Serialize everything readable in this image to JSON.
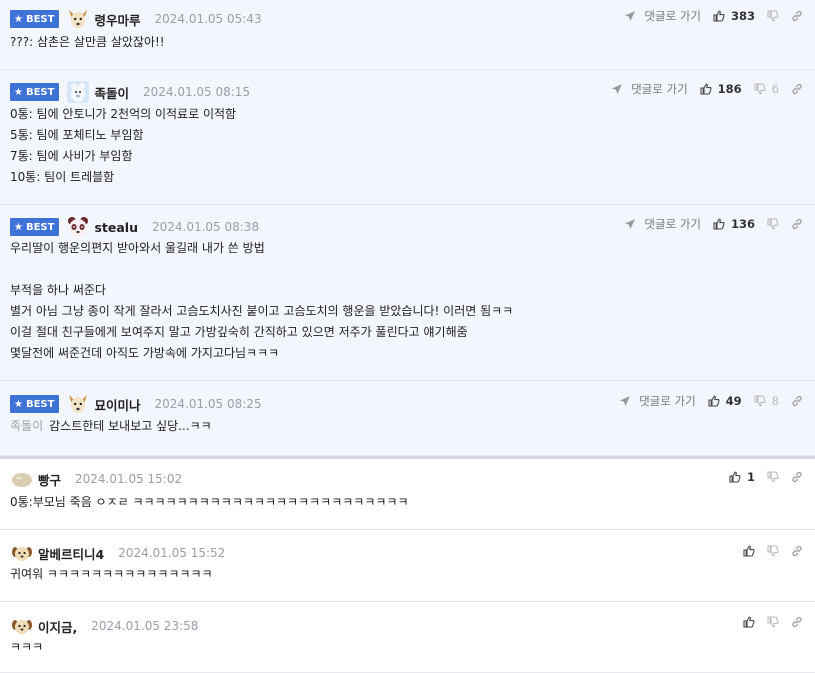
{
  "comments_best": [
    {
      "badge": "BEST",
      "nick": "령우마루",
      "date": "2024.01.05 05:43",
      "reply_link": "댓글로 가기",
      "likes": "383",
      "dislikes": "",
      "lines": [
        "???: 삼촌은 살만큼 살았잖아!!"
      ]
    },
    {
      "badge": "BEST",
      "nick": "족돌이",
      "date": "2024.01.05 08:15",
      "reply_link": "댓글로 가기",
      "likes": "186",
      "dislikes": "6",
      "lines": [
        "0통: 팀에 안토니가 2천억의 이적료로 이적함",
        "5통: 팀에 포체티노 부임함",
        "7통: 팀에 사비가 부임함",
        "10통: 팀이 트레블함"
      ]
    },
    {
      "badge": "BEST",
      "nick": "stealu",
      "date": "2024.01.05 08:38",
      "reply_link": "댓글로 가기",
      "likes": "136",
      "dislikes": "",
      "lines": [
        "우리딸이 행운의편지 받아와서 울길래 내가 쓴 방법",
        "",
        "부적을 하나 써준다",
        "별거 아님 그냥 종이 작게 잘라서 고슴도치사진 붙이고 고슴도치의 행운을 받았습니다! 이러면 됨ㅋㅋ",
        "이걸 절대 친구들에게 보여주지 말고 가방깊숙히 간직하고 있으면 저주가 풀린다고 얘기해줌",
        "몇달전에 써준건데 아직도 가방속에 가지고다님ㅋㅋㅋ"
      ]
    },
    {
      "badge": "BEST",
      "nick": "묘이미나",
      "date": "2024.01.05 08:25",
      "reply_link": "댓글로 가기",
      "likes": "49",
      "dislikes": "8",
      "mention": "족돌이",
      "lines": [
        "감스트한테 보내보고 싶당...ㅋㅋ"
      ]
    }
  ],
  "comments": [
    {
      "nick": "빵구",
      "date": "2024.01.05 15:02",
      "likes": "1",
      "lines": [
        "0통:부모님 죽음 ㅇㅈㄹ ㅋㅋㅋㅋㅋㅋㅋㅋㅋㅋㅋㅋㅋㅋㅋㅋㅋㅋㅋㅋㅋㅋㅋㅋㅋ"
      ]
    },
    {
      "nick": "알베르티니4",
      "date": "2024.01.05 15:52",
      "likes": "",
      "lines": [
        "귀여워 ㅋㅋㅋㅋㅋㅋㅋㅋㅋㅋㅋㅋㅋㅋㅋ"
      ]
    },
    {
      "nick": "이지금,",
      "date": "2024.01.05 23:58",
      "likes": "",
      "lines": [
        "ㅋㅋㅋ"
      ]
    }
  ],
  "icons": {
    "star": "★",
    "reply": "send-arrow-icon",
    "like": "thumbs-up-icon",
    "dislike": "thumbs-down-icon",
    "link": "link-icon"
  },
  "colors": {
    "best_badge": "#3d72d6",
    "best_bg": "#f3f6fc",
    "muted": "#9a9ea8"
  }
}
